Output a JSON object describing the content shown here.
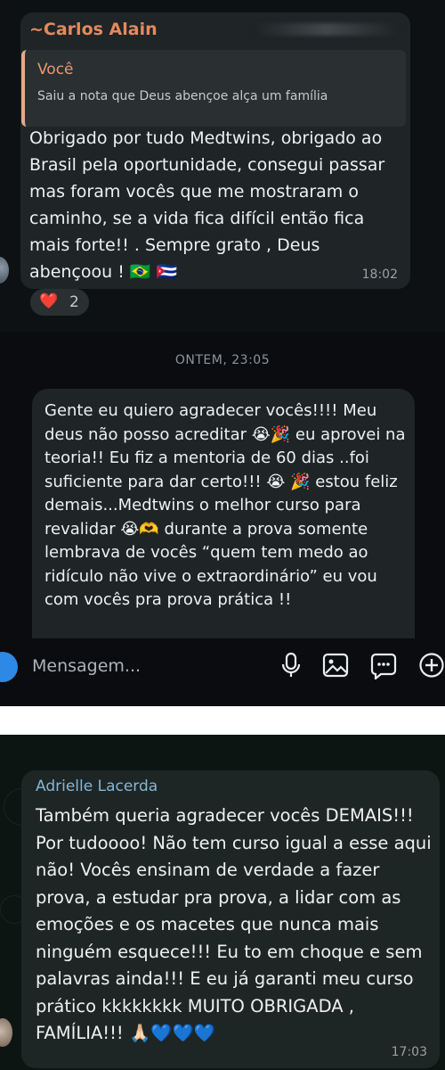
{
  "chat1": {
    "sender": "~Carlos Alain",
    "reply": {
      "author": "Você",
      "text": "Saiu a nota que Deus abençoe alça um família"
    },
    "body": "Obrigado por tudo Medtwins, obrigado ao Brasil pela oportunidade, consegui passar mas foram vocês que me mostraram o caminho, se a vida fica difícil então fica mais forte!! . Sempre grato , Deus abençoou ! 🇧🇷 🇨🇺",
    "time": "18:02",
    "reaction": {
      "emoji": "❤️",
      "count": "2"
    }
  },
  "chat2": {
    "date_separator": "ONTEM, 23:05",
    "body": "Gente eu quiero agradecer vocês!!!! Meu deus não posso acreditar 😭🎉 eu aprovei na teoria!! Eu fiz a mentoria de 60 dias ..foi suficiente para dar certo!!! 😭 🎉 estou feliz demais...Medtwins o melhor curso para revalidar 😭🫶 durante a prova somente lembrava de vocês “quem tem medo ao ridículo não vive o extraordinário” eu vou com vocês pra prova prática !!",
    "input_placeholder": "Mensagem...",
    "icons": [
      "camera-icon",
      "microphone-icon",
      "image-icon",
      "sticker-icon",
      "plus-icon"
    ]
  },
  "chat3": {
    "sender": "Adrielle Lacerda",
    "body": "Também queria agradecer vocês DEMAIS!!! Por tudoooo! Não tem curso igual a esse aqui não! Vocês ensinam de verdade a fazer prova, a estudar pra prova, a lidar com as emoções e os macetes que nunca mais ninguém esquece!!! Eu to em choque e sem palavras ainda!!! E eu já garanti meu curso prático kkkkkkkk MUITO OBRIGADA , FAMÍLIA!!! 🙏🏻💙💙💙",
    "time": "17:03"
  },
  "colors": {
    "bubble": "#1f2426",
    "sender_orange": "#e58a5e",
    "sender_blue": "#84b7d6",
    "accent_blue": "#2d89e5"
  }
}
